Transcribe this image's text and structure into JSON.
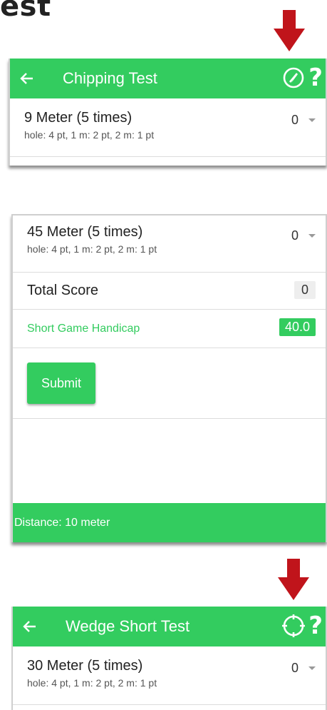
{
  "heading_fragment": "est",
  "colors": {
    "accent": "#33cc5f",
    "arrow": "#c0141b",
    "badge_gray": "#eeeeee"
  },
  "chipping": {
    "title": "Chipping Test",
    "icons": [
      "back-arrow-icon",
      "compass-icon",
      "help-icon"
    ],
    "help_label": "?",
    "row": {
      "label": "9 Meter (5 times)",
      "sub": "hole: 4 pt, 1 m: 2 pt, 2 m: 1 pt",
      "value": "0"
    }
  },
  "results": {
    "row": {
      "label": "45 Meter (5 times)",
      "sub": "hole: 4 pt, 1 m: 2 pt, 2 m: 1 pt",
      "value": "0"
    },
    "total_label": "Total Score",
    "total_value": "0",
    "handicap_label": "Short Game Handicap",
    "handicap_value": "40.0",
    "submit_label": "Submit",
    "footer_text": "Distance: 10 meter"
  },
  "wedge": {
    "title": "Wedge Short Test",
    "icons": [
      "back-arrow-icon",
      "crosshair-icon",
      "help-icon"
    ],
    "help_label": "?",
    "row": {
      "label": "30 Meter (5 times)",
      "sub": "hole: 4 pt, 1 m: 2 pt, 2 m: 1 pt",
      "value": "0"
    }
  }
}
